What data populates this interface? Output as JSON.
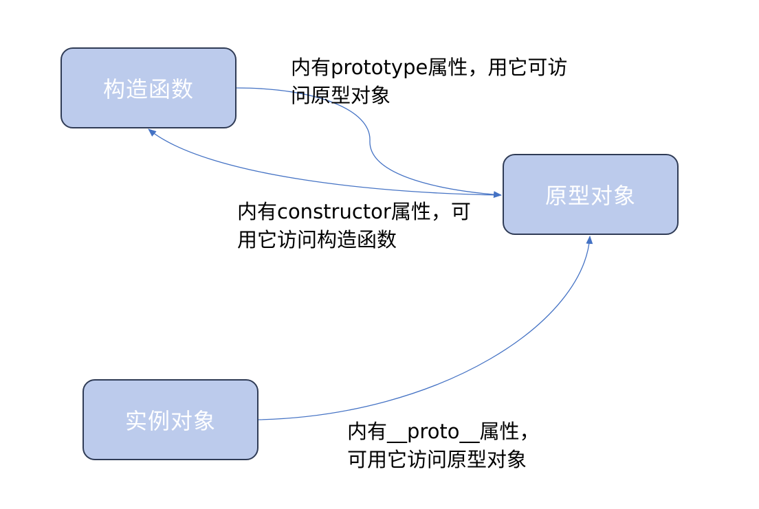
{
  "nodes": {
    "constructor": {
      "label": "构造函数"
    },
    "prototype": {
      "label": "原型对象"
    },
    "instance": {
      "label": "实例对象"
    }
  },
  "edges": {
    "prototype_property": {
      "line1": "内有prototype属性，用它可访",
      "line2": "问原型对象"
    },
    "constructor_property": {
      "line1": "内有constructor属性，可",
      "line2": "用它访问构造函数"
    },
    "proto_property": {
      "line1": "内有__proto__属性，",
      "line2": "可用它访问原型对象"
    }
  },
  "colors": {
    "node_fill": "#bccbec",
    "node_border": "#2f3b55",
    "edge": "#4472c4"
  }
}
